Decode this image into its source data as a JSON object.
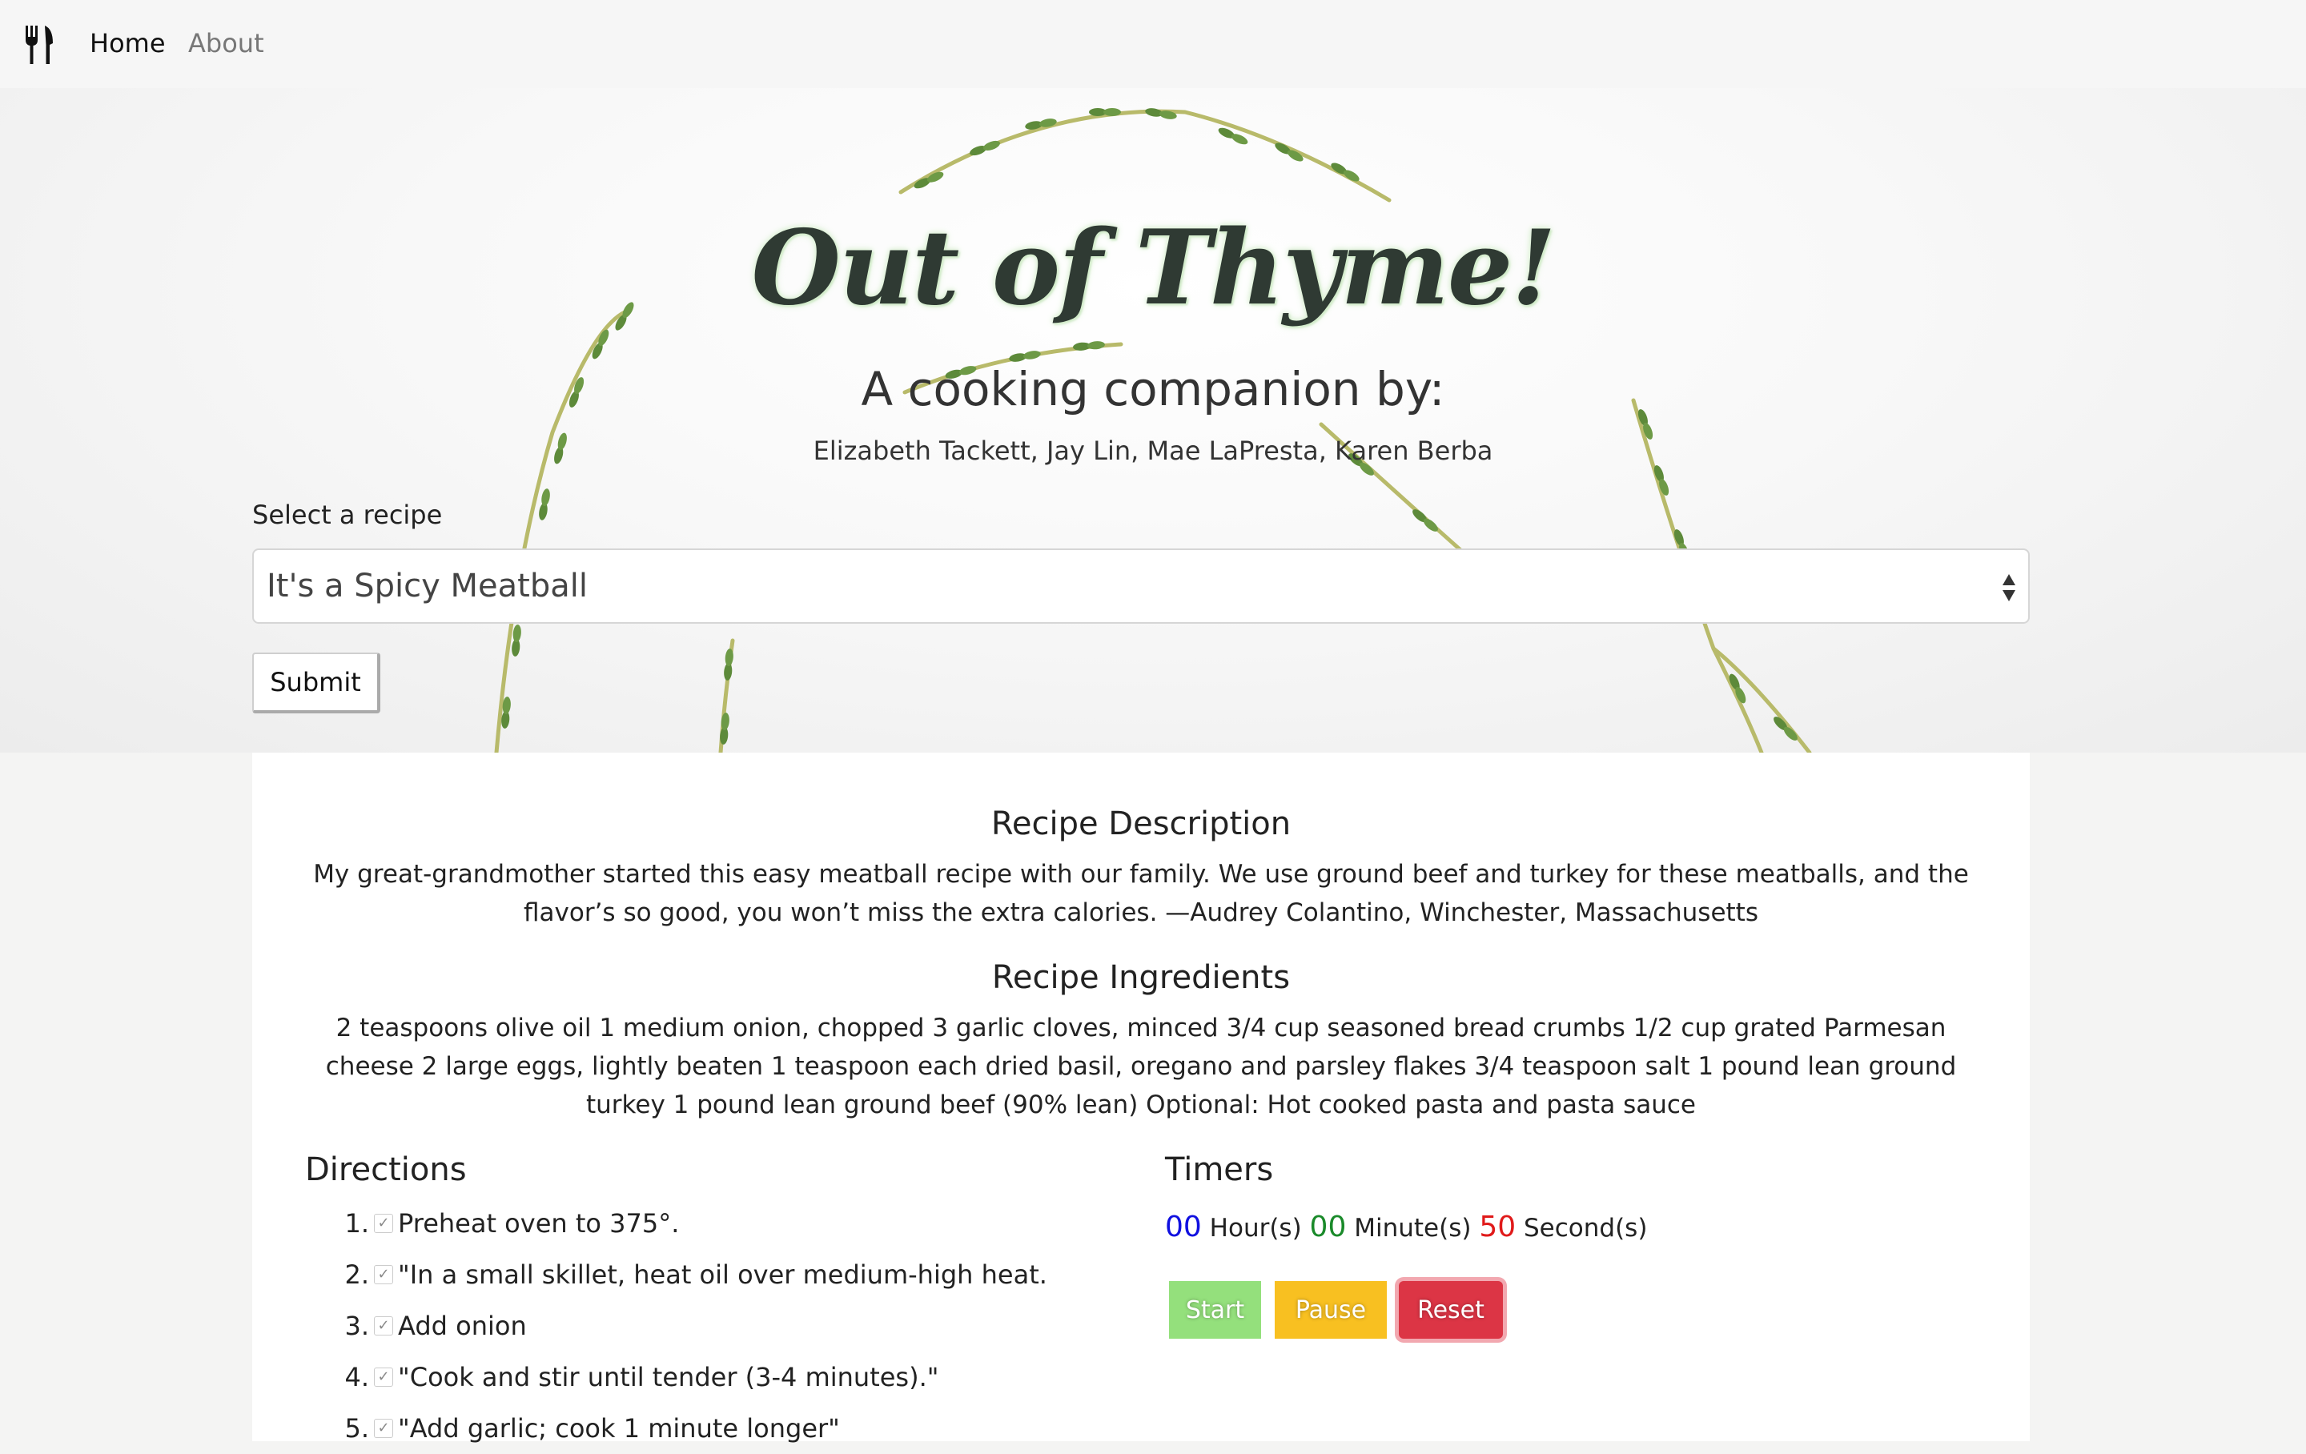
{
  "nav": {
    "logo_icon": "fork-knife-icon",
    "items": [
      {
        "label": "Home"
      },
      {
        "label": "About"
      }
    ]
  },
  "hero": {
    "title": "Out of Thyme!",
    "subtitle": "A cooking companion by:",
    "authors": "Elizabeth Tackett, Jay Lin, Mae LaPresta, Karen Berba"
  },
  "form": {
    "label": "Select a recipe",
    "selected": "It's a Spicy Meatball",
    "submit_label": "Submit"
  },
  "recipe": {
    "description_title": "Recipe Description",
    "description": "My great-grandmother started this easy meatball recipe with our family. We use ground beef and turkey for these meatballs, and the flavor’s so good, you won’t miss the extra calories. —Audrey Colantino, Winchester, Massachusetts",
    "ingredients_title": "Recipe Ingredients",
    "ingredients": "2 teaspoons olive oil 1 medium onion, chopped 3 garlic cloves, minced 3/4 cup seasoned bread crumbs 1/2 cup grated Parmesan cheese 2 large eggs, lightly beaten 1 teaspoon each dried basil, oregano and parsley flakes 3/4 teaspoon salt 1 pound lean ground turkey 1 pound lean ground beef (90% lean) Optional: Hot cooked pasta and pasta sauce"
  },
  "directions": {
    "title": "Directions",
    "items": [
      {
        "num": "1.",
        "text": "Preheat oven to 375°."
      },
      {
        "num": "2.",
        "text": "\"In a small skillet, heat oil over medium-high heat."
      },
      {
        "num": "3.",
        "text": "Add onion"
      },
      {
        "num": "4.",
        "text": "\"Cook and stir until tender (3-4 minutes).\""
      },
      {
        "num": "5.",
        "text": "\"Add garlic; cook 1 minute longer\""
      }
    ]
  },
  "timers": {
    "title": "Timers",
    "hours": "00",
    "hours_label": "Hour(s)",
    "minutes": "00",
    "minutes_label": "Minute(s)",
    "seconds": "50",
    "seconds_label": "Second(s)",
    "start_label": "Start",
    "pause_label": "Pause",
    "reset_label": "Reset"
  },
  "colors": {
    "hours": "#1010e0",
    "minutes": "#1a8a2a",
    "seconds": "#e01a1a",
    "start": "#94e07c",
    "pause": "#f8c021",
    "reset": "#dc3545"
  }
}
